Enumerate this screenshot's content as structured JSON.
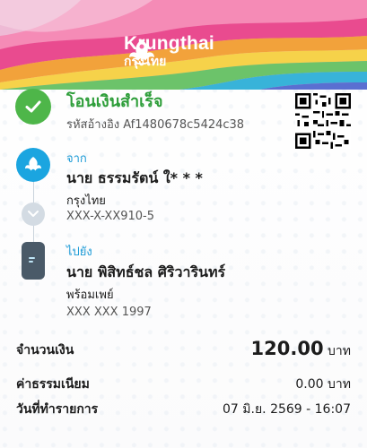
{
  "brand": {
    "name_en": "Krungthai",
    "name_th": "กรุงไทย",
    "logo_icon": "krungthai-bird-logo"
  },
  "status": {
    "title": "โอนเงินสำเร็จ",
    "ref_label": "รหัสอ้างอิง",
    "ref_value": "Af1480678c5424c38",
    "icon": "check-icon",
    "color": "#4eb649"
  },
  "qr": {
    "icon": "qr-code"
  },
  "from": {
    "label": "จาก",
    "name": "นาย ธรรมรัตน์ ใ* * *",
    "bank": "กรุงไทย",
    "account": "XXX-X-XX910-5",
    "icon": "krungthai-bird-icon"
  },
  "to": {
    "label": "ไปยัง",
    "name": "นาย พิสิทธ์ชล ศิริวารินทร์",
    "bank": "พร้อมเพย์",
    "account": "XXX XXX 1997",
    "icon": "phone-icon"
  },
  "details": {
    "amount_label": "จำนวนเงิน",
    "amount_value": "120.00",
    "amount_unit": "บาท",
    "fee_label": "ค่าธรรมเนียม",
    "fee_value": "0.00 บาท",
    "date_label": "วันที่ทำรายการ",
    "date_value": "07 มิ.ย. 2569 - 16:07"
  },
  "colors": {
    "accent_blue": "#1b9ad6",
    "success_green": "#2e9e3a"
  }
}
